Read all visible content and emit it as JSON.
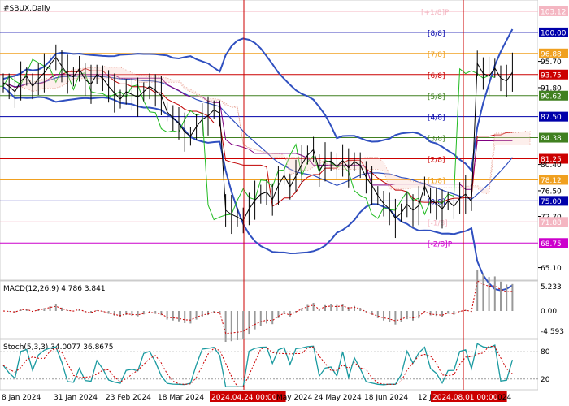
{
  "chart_data": {
    "type": "line",
    "title": "#SBUX,Daily",
    "price_ticks": [
      "103.12",
      "100.00",
      "96.88",
      "95.70",
      "93.75",
      "91.80",
      "90.62",
      "87.50",
      "84.38",
      "81.25",
      "80.40",
      "78.12",
      "76.50",
      "75.00",
      "72.70",
      "71.88",
      "68.75",
      "65.10"
    ],
    "murrey_levels": [
      {
        "label": "[+1/8]P",
        "value": 103.12,
        "color": "#f4b6c2"
      },
      {
        "label": "[8/8]",
        "value": 100.0,
        "color": "#0000aa"
      },
      {
        "label": "[7/8]",
        "value": 96.88,
        "color": "#f0a020"
      },
      {
        "label": "[6/8]",
        "value": 93.75,
        "color": "#cc0000"
      },
      {
        "label": "[5/8]",
        "value": 90.62,
        "color": "#408020"
      },
      {
        "label": "[4/8]",
        "value": 87.5,
        "color": "#0000aa"
      },
      {
        "label": "[3/8]",
        "value": 84.38,
        "color": "#408020"
      },
      {
        "label": "[2/8]",
        "value": 81.25,
        "color": "#cc0000"
      },
      {
        "label": "[1/8]",
        "value": 78.12,
        "color": "#f0a020"
      },
      {
        "label": "[0/8]",
        "value": 75.0,
        "color": "#0000aa"
      },
      {
        "label": "[-1/8]",
        "value": 71.88,
        "color": "#f4b6c2"
      },
      {
        "label": "[-2/8]P",
        "value": 68.75,
        "color": "#cc00cc"
      }
    ],
    "tag_colors": {
      "100.00": "#0000aa",
      "96.88": "#f0a020",
      "93.75": "#cc0000",
      "90.62": "#408020",
      "87.50": "#0000aa",
      "84.38": "#408020",
      "81.25": "#cc0000",
      "78.12": "#f0a020",
      "75.00": "#0000aa",
      "71.88": "#f4b6c2",
      "68.75": "#cc00cc",
      "103.12": "#f4b6c2"
    },
    "highlight_ticks": [
      "103.12",
      "100.00",
      "96.88",
      "93.75",
      "90.62",
      "87.50",
      "84.38",
      "81.25",
      "78.12",
      "75.00",
      "71.88",
      "68.75"
    ],
    "ylim": [
      64.5,
      104.2
    ],
    "close": [
      92.5,
      92.0,
      91.2,
      92.8,
      93.5,
      92.0,
      93.1,
      94.0,
      95.2,
      96.3,
      95.0,
      93.8,
      93.4,
      94.6,
      93.0,
      92.3,
      93.8,
      93.2,
      92.0,
      91.0,
      90.1,
      91.2,
      90.8,
      90.4,
      91.2,
      92.0,
      91.4,
      90.6,
      88.2,
      87.3,
      86.5,
      85.2,
      84.6,
      86.0,
      87.1,
      87.6,
      88.5,
      88.0,
      73.6,
      73.0,
      72.6,
      72.1,
      73.8,
      75.1,
      76.0,
      76.3,
      75.2,
      77.3,
      78.8,
      77.1,
      78.7,
      80.4,
      81.8,
      82.6,
      79.5,
      80.8,
      80.9,
      80.1,
      81.0,
      79.9,
      80.8,
      80.3,
      78.5,
      77.3,
      75.8,
      74.6,
      73.8,
      72.4,
      73.2,
      74.5,
      73.6,
      74.3,
      77.2,
      75.1,
      74.6,
      73.8,
      75.0,
      74.2,
      75.4,
      76.0,
      74.9,
      95.4,
      93.9,
      93.5,
      94.7,
      93.2,
      92.8,
      94.1
    ],
    "macd": {
      "label": "MACD(12,26,9) 4.786 3.841",
      "ticks": [
        "5.233",
        "0.00",
        "-4.593"
      ],
      "range": [
        -4.593,
        5.233
      ],
      "main": 4.786,
      "signal": 3.841
    },
    "stoch": {
      "label": "Stoch(5,3,3) 34.0077 36.8675",
      "ticks": [
        "80",
        "20"
      ],
      "range": [
        0,
        100
      ],
      "main": 34.0077,
      "signal": 36.8675
    },
    "dates": [
      "8 Jan 2024",
      "31 Jan 2024",
      "23 Feb 2024",
      "18 Mar 2024",
      "2024.04.24 00:00",
      "May 2024",
      "24 May 2024",
      "18 Jun 2024",
      "12 J",
      "2024.08.01 00:00",
      "024"
    ],
    "markers": [
      "2024.04.24 00:00",
      "2024.08.01 00:00"
    ]
  }
}
